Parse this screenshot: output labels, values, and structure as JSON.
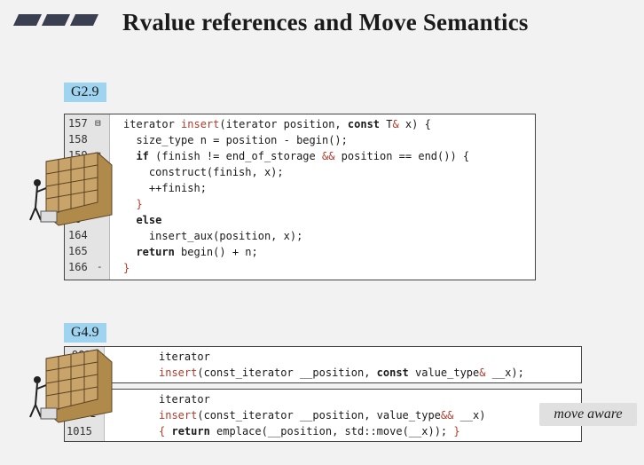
{
  "title": "Rvalue references and Move Semantics",
  "g29": {
    "label": "G2.9",
    "lines": [
      {
        "n": "157",
        "m": "⊟"
      },
      {
        "n": "158",
        "m": ""
      },
      {
        "n": "159",
        "m": "⊟"
      },
      {
        "n": "",
        "m": ""
      },
      {
        "n": "",
        "m": ""
      },
      {
        "n": "",
        "m": ""
      },
      {
        "n": "16",
        "m": ""
      },
      {
        "n": "164",
        "m": ""
      },
      {
        "n": "165",
        "m": ""
      },
      {
        "n": "166",
        "m": "-"
      }
    ],
    "code": [
      [
        "t",
        "iterator "
      ],
      [
        "h",
        "insert"
      ],
      [
        "t",
        "(iterator position, "
      ],
      [
        "k",
        "const"
      ],
      [
        "t",
        " T"
      ],
      [
        "h",
        "&"
      ],
      [
        "t",
        " x) {"
      ]
    ]
  },
  "g49": {
    "label": "G4.9",
    "box1_ln": "983",
    "box2_ln_a": "1",
    "box2_ln_b": "1015"
  },
  "note": "move aware"
}
